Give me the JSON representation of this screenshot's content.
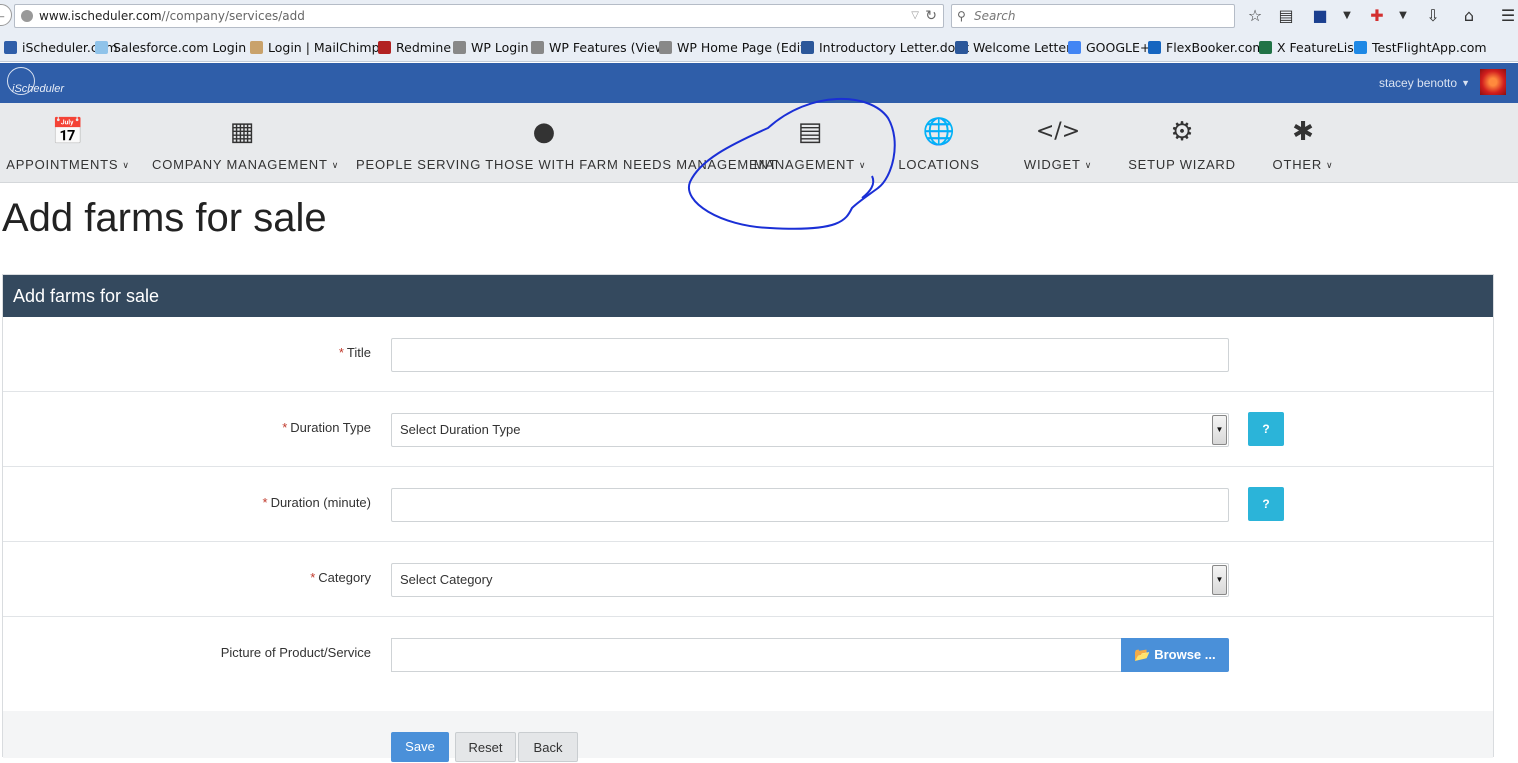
{
  "browser": {
    "url_host": "www.ischeduler.com",
    "url_path": "//company/services/add",
    "search_placeholder": "Search"
  },
  "bookmarks": [
    {
      "label": "iScheduler.com",
      "color": "#2f5ea9"
    },
    {
      "label": "Salesforce.com Login ...",
      "color": "#8fc3ea"
    },
    {
      "label": "Login | MailChimp",
      "color": "#c9a26b"
    },
    {
      "label": "Redmine",
      "color": "#b22222"
    },
    {
      "label": "WP Login",
      "color": "#888888"
    },
    {
      "label": "WP Features (View)",
      "color": "#888888"
    },
    {
      "label": "WP Home Page (Edit)",
      "color": "#888888"
    },
    {
      "label": "Introductory Letter.docx",
      "color": "#2b579a"
    },
    {
      "label": "Welcome Letter",
      "color": "#2b579a"
    },
    {
      "label": "GOOGLE+",
      "color": "#4285f4"
    },
    {
      "label": "FlexBooker.com",
      "color": "#1565c0"
    },
    {
      "label": "X FeatureList",
      "color": "#217346"
    },
    {
      "label": "TestFlightApp.com",
      "color": "#1e88e5"
    }
  ],
  "header": {
    "logo_text": "iScheduler",
    "user_name": "stacey benotto"
  },
  "nav": [
    {
      "label": "APPOINTMENTS",
      "icon": "calendar-icon",
      "dropdown": true
    },
    {
      "label": "COMPANY MANAGEMENT",
      "icon": "building-icon",
      "dropdown": true
    },
    {
      "label": "PEOPLE SERVING THOSE WITH FARM NEEDS MANAGEMENT",
      "icon": "user-icon",
      "dropdown": false
    },
    {
      "label": "MANAGEMENT",
      "icon": "list-icon",
      "dropdown": true
    },
    {
      "label": "LOCATIONS",
      "icon": "globe-icon",
      "dropdown": false
    },
    {
      "label": "WIDGET",
      "icon": "code-icon",
      "dropdown": true
    },
    {
      "label": "SETUP WIZARD",
      "icon": "gears-icon",
      "dropdown": false
    },
    {
      "label": "OTHER",
      "icon": "asterisk-icon",
      "dropdown": true
    }
  ],
  "page": {
    "title": "Add farms for sale",
    "panel_title": "Add farms for sale"
  },
  "form": {
    "title_label": "Title",
    "duration_type_label": "Duration Type",
    "duration_type_value": "Select Duration Type",
    "duration_minute_label": "Duration (minute)",
    "category_label": "Category",
    "category_value": "Select Category",
    "picture_label": "Picture of Product/Service",
    "browse_label": "Browse ...",
    "help_label": "?",
    "required_mark": "*"
  },
  "actions": {
    "save": "Save",
    "reset": "Reset",
    "back": "Back"
  },
  "colors": {
    "header_blue": "#2f5ea9",
    "panel_head": "#34495e",
    "help_cyan": "#2bb4d9",
    "primary_blue": "#4a90d9",
    "annotation_circle": "#1a2fd6"
  }
}
